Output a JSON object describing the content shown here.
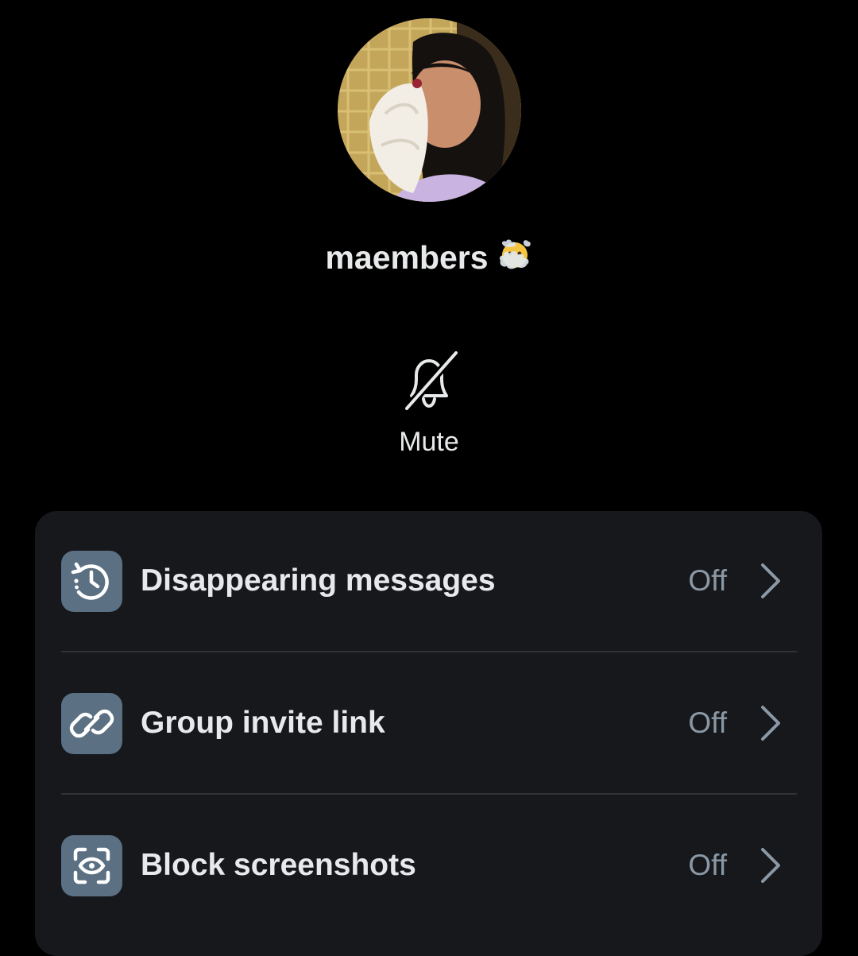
{
  "conversation": {
    "name": "maembers",
    "name_emoji": "😶‍🌫️"
  },
  "actions": {
    "mute_label": "Mute"
  },
  "settings": [
    {
      "id": "disappearing-messages",
      "icon": "timer-history-icon",
      "label": "Disappearing messages",
      "value": "Off"
    },
    {
      "id": "group-invite-link",
      "icon": "link-icon",
      "label": "Group invite link",
      "value": "Off"
    },
    {
      "id": "block-screenshots",
      "icon": "screenshot-block-icon",
      "label": "Block screenshots",
      "value": "Off"
    }
  ],
  "colors": {
    "background": "#000000",
    "card": "#16181c",
    "icon_tile": "#5b7083",
    "primary_text": "#e7e9ea",
    "secondary_text": "#8b98a5",
    "divider": "#2f3336"
  }
}
